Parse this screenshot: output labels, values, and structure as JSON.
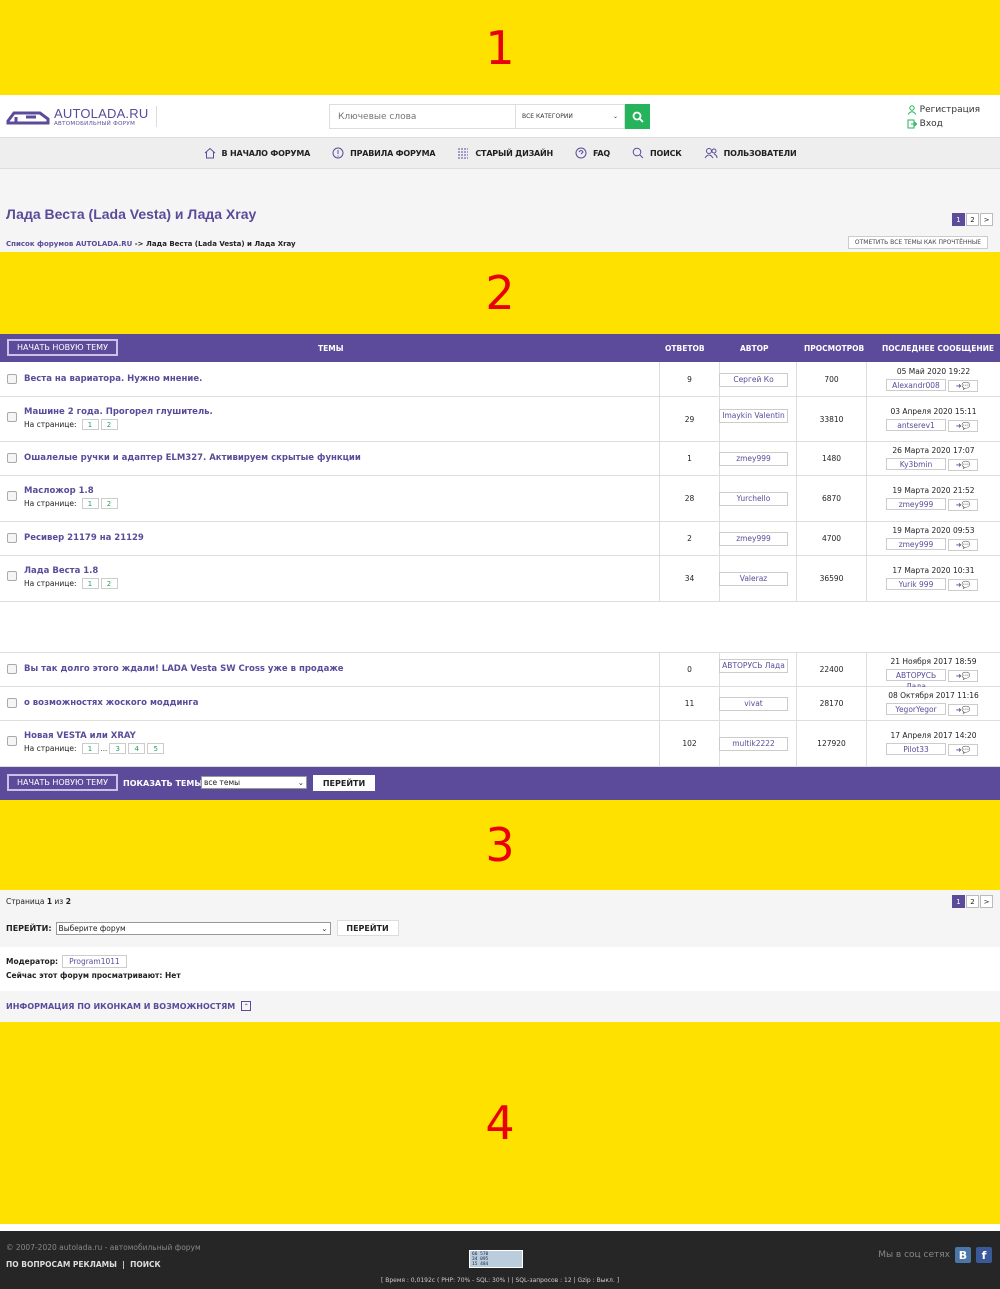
{
  "ads": [
    "1",
    "2",
    "3",
    "4"
  ],
  "header": {
    "logo_name": "AUTOLADA.RU",
    "logo_sub": "АВТОМОБИЛЬНЫЙ ФОРУМ",
    "search_placeholder": "Ключевые слова",
    "category": "ВСЕ КАТЕГОРИИ",
    "register": "Регистрация",
    "login": "Вход"
  },
  "nav": [
    {
      "label": "В НАЧАЛО ФОРУМА",
      "icon": "home-icon"
    },
    {
      "label": "ПРАВИЛА ФОРУМА",
      "icon": "info-icon"
    },
    {
      "label": "СТАРЫЙ ДИЗАЙН",
      "icon": "list-icon"
    },
    {
      "label": "FAQ",
      "icon": "faq-icon"
    },
    {
      "label": "ПОИСК",
      "icon": "search-icon"
    },
    {
      "label": "ПОЛЬЗОВАТЕЛИ",
      "icon": "users-icon"
    }
  ],
  "forum": {
    "title": "Лада Веста (Lada Vesta) и Лада Xray",
    "pages": [
      "1",
      "2",
      ">"
    ],
    "crumb_root": "Список форумов AUTOLADA.RU",
    "crumb_sep": " -> ",
    "crumb_current": "Лада Веста (Lada Vesta) и Лада Xray",
    "mark_read": "ОТМЕТИТЬ ВСЕ ТЕМЫ КАК ПРОЧТЁННЫЕ"
  },
  "table": {
    "new_topic": "НАЧАТЬ НОВУЮ ТЕМУ",
    "col_topics": "ТЕМЫ",
    "col_replies": "ОТВЕТОВ",
    "col_author": "АВТОР",
    "col_views": "ПРОСМОТРОВ",
    "col_last": "ПОСЛЕДНЕЕ СООБЩЕНИЕ",
    "pages_label": "На странице:",
    "rows": [
      {
        "title": "Веста на вариатора. Нужно мнение.",
        "pages": [],
        "replies": "9",
        "author": "Сергей Ко",
        "views": "700",
        "last_date": "05 Май 2020 19:22",
        "last_user": "Alexandr008"
      },
      {
        "title": "Машине 2 года. Прогорел глушитель.",
        "pages": [
          "1",
          "2"
        ],
        "replies": "29",
        "author": "Imaykin Valentin",
        "views": "33810",
        "last_date": "03 Апреля 2020 15:11",
        "last_user": "antserev1"
      },
      {
        "title": "Ошалелые ручки и адаптер ELM327. Активируем скрытые функции",
        "pages": [],
        "replies": "1",
        "author": "zmey999",
        "views": "1480",
        "last_date": "26 Марта 2020 17:07",
        "last_user": "Ky3bmin"
      },
      {
        "title": "Масложор 1.8",
        "pages": [
          "1",
          "2"
        ],
        "replies": "28",
        "author": "Yurchello",
        "views": "6870",
        "last_date": "19 Марта 2020 21:52",
        "last_user": "zmey999"
      },
      {
        "title": "Ресивер 21179 на 21129",
        "pages": [],
        "replies": "2",
        "author": "zmey999",
        "views": "4700",
        "last_date": "19 Марта 2020 09:53",
        "last_user": "zmey999"
      },
      {
        "title": "Лада Веста 1.8",
        "pages": [
          "1",
          "2"
        ],
        "replies": "34",
        "author": "Valeraz",
        "views": "36590",
        "last_date": "17 Марта 2020 10:31",
        "last_user": "Yurik 999"
      },
      {
        "title": "Вы так долго этого ждали! LADA Vesta SW Cross уже в продаже",
        "pages": [],
        "replies": "0",
        "author": "АВТОРУСЬ Лада",
        "views": "22400",
        "last_date": "21 Ноября 2017 18:59",
        "last_user": "АВТОРУСЬ Лада"
      },
      {
        "title": "о возможностях жоского моддинга",
        "pages": [],
        "replies": "11",
        "author": "vivat",
        "views": "28170",
        "last_date": "08 Октября 2017 11:16",
        "last_user": "YegorYegor"
      },
      {
        "title": "Новая VESTA или XRAY",
        "pages": [
          "1",
          "...",
          "3",
          "4",
          "5"
        ],
        "replies": "102",
        "author": "multik2222",
        "views": "127920",
        "last_date": "17 Апреля 2017 14:20",
        "last_user": "Pilot33"
      }
    ],
    "show_topics": "ПОКАЗАТЬ ТЕМЫ:",
    "show_select": "все темы",
    "go": "ПЕРЕЙТИ"
  },
  "bottom": {
    "page_prefix": "Страница ",
    "page_cur": "1",
    "page_mid": " из ",
    "page_total": "2",
    "pages": [
      "1",
      "2",
      ">"
    ],
    "jump_label": "ПЕРЕЙТИ:",
    "jump_select": "Выберите форум",
    "jump_go": "ПЕРЕЙТИ",
    "moderator_label": "Модератор:",
    "moderator": "Program1011",
    "viewing": "Сейчас этот форум просматривают: Нет",
    "icon_info": "ИНФОРМАЦИЯ ПО ИКОНКАМ И ВОЗМОЖНОСТЯМ"
  },
  "footer": {
    "copyright": "© 2007-2020 autolada.ru - автомобильный форум",
    "ads_link": "ПО ВОПРОСАМ РЕКЛАМЫ",
    "search_link": "ПОИСК",
    "counter": [
      "66 570",
      "34 095",
      "15 484"
    ],
    "stats": "[ Время : 0,0192с ( PHP: 70% - SQL: 30% ) | SQL-запросов : 12 | Gzip : Выкл. ]",
    "social": "Мы в соц сетях",
    "vk": "В",
    "fb": "f"
  },
  "colors": {
    "accent": "#5b4b9a",
    "ad_bg": "#ffe100",
    "ad_num": "#e8000b",
    "search_btn": "#25b35b"
  }
}
